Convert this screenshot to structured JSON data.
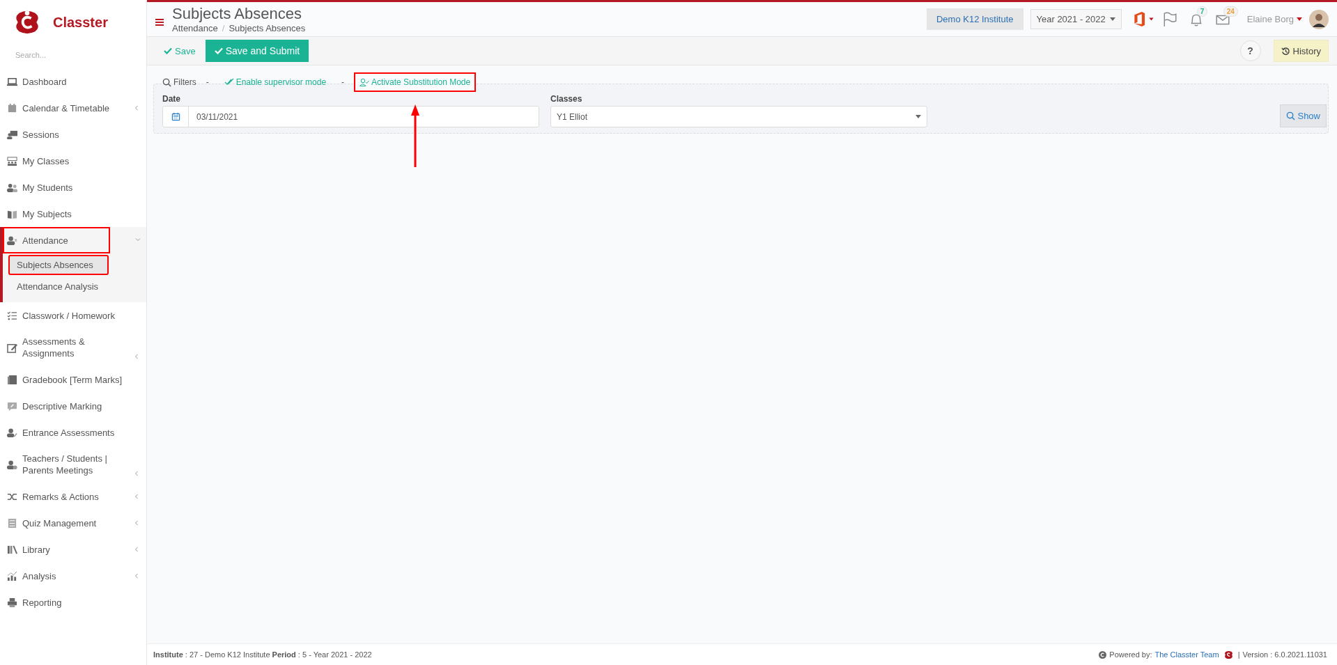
{
  "sidebar": {
    "logo_text": "Classter",
    "search": {
      "placeholder": "Search..."
    },
    "items": [
      {
        "label": "Dashboard",
        "kind": "link",
        "highlighted": false
      },
      {
        "label": "Calendar & Timetable",
        "kind": "group",
        "expanded": false,
        "highlighted": false
      },
      {
        "label": "Sessions",
        "kind": "link",
        "highlighted": false
      },
      {
        "label": "My Classes",
        "kind": "link",
        "highlighted": false
      },
      {
        "label": "My Students",
        "kind": "link",
        "highlighted": false
      },
      {
        "label": "My Subjects",
        "kind": "link",
        "highlighted": false
      },
      {
        "label": "Attendance",
        "kind": "group",
        "expanded": true,
        "highlighted": true,
        "children": [
          {
            "label": "Subjects Absences",
            "selected": true,
            "highlighted": true
          },
          {
            "label": "Attendance Analysis",
            "selected": false,
            "highlighted": false
          }
        ]
      },
      {
        "label": "Classwork / Homework",
        "kind": "link",
        "highlighted": false
      },
      {
        "label": "Assessments & Assignments",
        "kind": "group",
        "expanded": false,
        "highlighted": false
      },
      {
        "label": "Gradebook [Term Marks]",
        "kind": "link",
        "highlighted": false
      },
      {
        "label": "Descriptive Marking",
        "kind": "link",
        "highlighted": false
      },
      {
        "label": "Entrance Assessments",
        "kind": "link",
        "highlighted": false
      },
      {
        "label": "Teachers / Students | Parents Meetings",
        "kind": "group",
        "expanded": false,
        "highlighted": false
      },
      {
        "label": "Remarks & Actions",
        "kind": "group",
        "expanded": false,
        "highlighted": false
      },
      {
        "label": "Quiz Management",
        "kind": "group",
        "expanded": false,
        "highlighted": false
      },
      {
        "label": "Library",
        "kind": "group",
        "expanded": false,
        "highlighted": false
      },
      {
        "label": "Analysis",
        "kind": "group",
        "expanded": false,
        "highlighted": false
      },
      {
        "label": "Reporting",
        "kind": "link",
        "highlighted": false
      }
    ]
  },
  "header": {
    "title": "Subjects Absences",
    "breadcrumb": [
      "Attendance",
      "Subjects Absences"
    ],
    "breadcrumb_separator": "/",
    "institute": "Demo K12 Institute",
    "year": "Year 2021 - 2022",
    "notifications": "7",
    "messages": "24",
    "user": "Elaine Borg"
  },
  "toolbar": {
    "save": "Save",
    "save_submit": "Save and Submit",
    "help": "?",
    "history": "History"
  },
  "filters": {
    "label": "Filters",
    "links": [
      {
        "separator": "-",
        "label": "Enable supervisor mode",
        "highlighted": false
      },
      {
        "separator": "-",
        "label": "Activate Substitution Mode",
        "highlighted": true
      }
    ],
    "date": {
      "label": "Date",
      "value": "03/11/2021"
    },
    "classes": {
      "label": "Classes",
      "value": "Y1 Elliot"
    },
    "show": "Show"
  },
  "footer": {
    "info": "**Institute** : 27 - Demo K12 Institute **Period** : 5 - Year 2021 - 2022",
    "powered": "Powered by:",
    "team": "The Classter Team",
    "separator": "|",
    "version": "Version : 6.0.2021.11031"
  }
}
